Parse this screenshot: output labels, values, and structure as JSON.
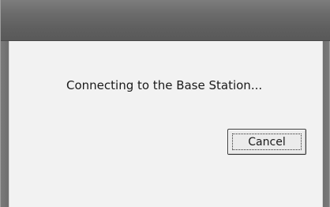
{
  "dialog": {
    "message": "Connecting to the Base Station...",
    "cancel_label": "Cancel"
  }
}
